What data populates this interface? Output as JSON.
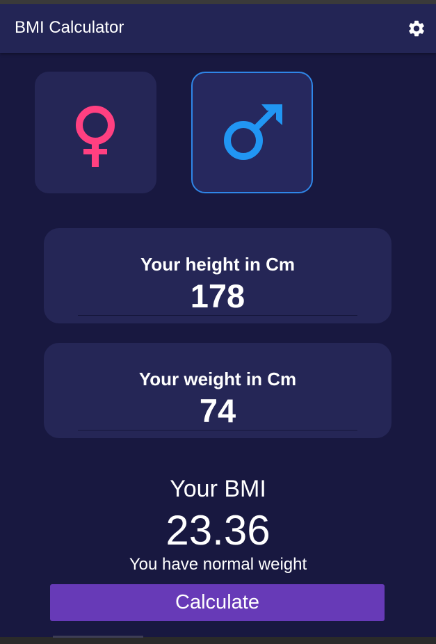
{
  "app": {
    "title": "BMI Calculator",
    "settings_icon": "gear-icon"
  },
  "gender": {
    "options": [
      {
        "name": "female",
        "icon": "female-symbol-icon",
        "color": "#ff4081",
        "selected": false
      },
      {
        "name": "male",
        "icon": "male-symbol-icon",
        "color": "#2196f3",
        "selected": true
      }
    ]
  },
  "height": {
    "label": "Your height in Cm",
    "value": "178"
  },
  "weight": {
    "label": "Your weight in Cm",
    "value": "74"
  },
  "result": {
    "title": "Your BMI",
    "value": "23.36",
    "message": "You have normal weight"
  },
  "actions": {
    "calculate_label": "Calculate"
  },
  "colors": {
    "background": "#181840",
    "card": "#252656",
    "appbar": "#232555",
    "accent_button": "#673ab7",
    "selected_border": "#2f86e8"
  }
}
